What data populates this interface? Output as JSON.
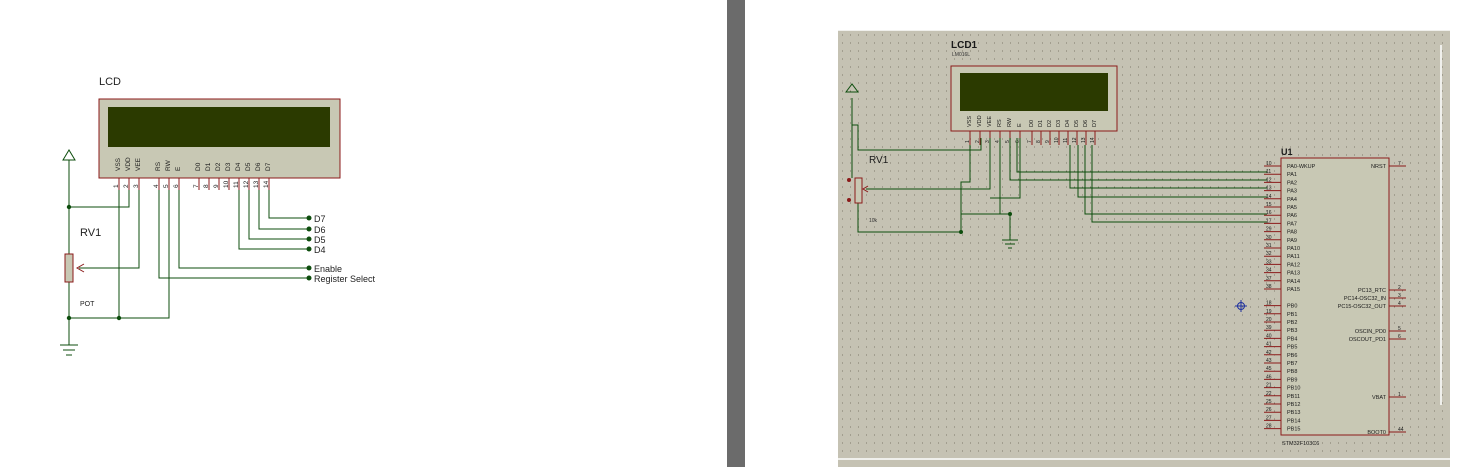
{
  "left_schematic": {
    "lcd_title": "LCD",
    "lcd_pins": [
      {
        "name": "VSS",
        "num": "1"
      },
      {
        "name": "VDD",
        "num": "2"
      },
      {
        "name": "VEE",
        "num": "3"
      },
      {
        "name": "RS",
        "num": "4"
      },
      {
        "name": "RW",
        "num": "5"
      },
      {
        "name": "E",
        "num": "6"
      },
      {
        "name": "D0",
        "num": "7"
      },
      {
        "name": "D1",
        "num": "8"
      },
      {
        "name": "D2",
        "num": "9"
      },
      {
        "name": "D3",
        "num": "10"
      },
      {
        "name": "D4",
        "num": "11"
      },
      {
        "name": "D5",
        "num": "12"
      },
      {
        "name": "D6",
        "num": "13"
      },
      {
        "name": "D7",
        "num": "14"
      }
    ],
    "pot_ref": "RV1",
    "pot_label": "POT",
    "net_labels": [
      "D7",
      "D6",
      "D5",
      "D4",
      "Enable",
      "Register Select"
    ]
  },
  "right_schematic": {
    "lcd_ref": "LCD1",
    "lcd_part": "LM016L",
    "lcd_pins": [
      {
        "name": "VSS",
        "num": "1"
      },
      {
        "name": "VDD",
        "num": "2"
      },
      {
        "name": "VEE",
        "num": "3"
      },
      {
        "name": "RS",
        "num": "4"
      },
      {
        "name": "RW",
        "num": "5"
      },
      {
        "name": "E",
        "num": "6"
      },
      {
        "name": "D0",
        "num": "7"
      },
      {
        "name": "D1",
        "num": "8"
      },
      {
        "name": "D2",
        "num": "9"
      },
      {
        "name": "D3",
        "num": "10"
      },
      {
        "name": "D4",
        "num": "11"
      },
      {
        "name": "D5",
        "num": "12"
      },
      {
        "name": "D6",
        "num": "13"
      },
      {
        "name": "D7",
        "num": "14"
      }
    ],
    "pot_ref": "RV1",
    "pot_value": "10k",
    "mcu_ref": "U1",
    "mcu_part": "STM32F103C6",
    "mcu_left_pins": [
      {
        "num": "10",
        "name": "PA0-WKUP"
      },
      {
        "num": "11",
        "name": "PA1"
      },
      {
        "num": "12",
        "name": "PA2"
      },
      {
        "num": "13",
        "name": "PA3"
      },
      {
        "num": "14",
        "name": "PA4"
      },
      {
        "num": "15",
        "name": "PA5"
      },
      {
        "num": "16",
        "name": "PA6"
      },
      {
        "num": "17",
        "name": "PA7"
      },
      {
        "num": "29",
        "name": "PA8"
      },
      {
        "num": "30",
        "name": "PA9"
      },
      {
        "num": "31",
        "name": "PA10"
      },
      {
        "num": "32",
        "name": "PA11"
      },
      {
        "num": "33",
        "name": "PA12"
      },
      {
        "num": "34",
        "name": "PA13"
      },
      {
        "num": "37",
        "name": "PA14"
      },
      {
        "num": "38",
        "name": "PA15"
      },
      {
        "num": "18",
        "name": "PB0"
      },
      {
        "num": "19",
        "name": "PB1"
      },
      {
        "num": "20",
        "name": "PB2"
      },
      {
        "num": "39",
        "name": "PB3"
      },
      {
        "num": "40",
        "name": "PB4"
      },
      {
        "num": "41",
        "name": "PB5"
      },
      {
        "num": "42",
        "name": "PB6"
      },
      {
        "num": "43",
        "name": "PB7"
      },
      {
        "num": "45",
        "name": "PB8"
      },
      {
        "num": "46",
        "name": "PB9"
      },
      {
        "num": "21",
        "name": "PB10"
      },
      {
        "num": "22",
        "name": "PB11"
      },
      {
        "num": "25",
        "name": "PB12"
      },
      {
        "num": "26",
        "name": "PB13"
      },
      {
        "num": "27",
        "name": "PB14"
      },
      {
        "num": "28",
        "name": "PB15"
      }
    ],
    "mcu_right_pins": [
      {
        "num": "7",
        "name": "NRST"
      },
      {
        "num": "2",
        "name": "PC13_RTC"
      },
      {
        "num": "3",
        "name": "PC14-OSC32_IN"
      },
      {
        "num": "4",
        "name": "PC15-OSC32_OUT"
      },
      {
        "num": "5",
        "name": "OSCIN_PD0"
      },
      {
        "num": "6",
        "name": "OSCOUT_PD1"
      },
      {
        "num": "1",
        "name": "VBAT"
      },
      {
        "num": "44",
        "name": "BOOT0"
      }
    ]
  },
  "colors": {
    "wire": "#0d4d0d",
    "pin_red": "#8b1a1a",
    "lcd_body": "#c8c8b4",
    "lcd_screen": "#2b3a00",
    "grid_bg": "#c5c2b3",
    "divider": "#6b6b6b"
  }
}
